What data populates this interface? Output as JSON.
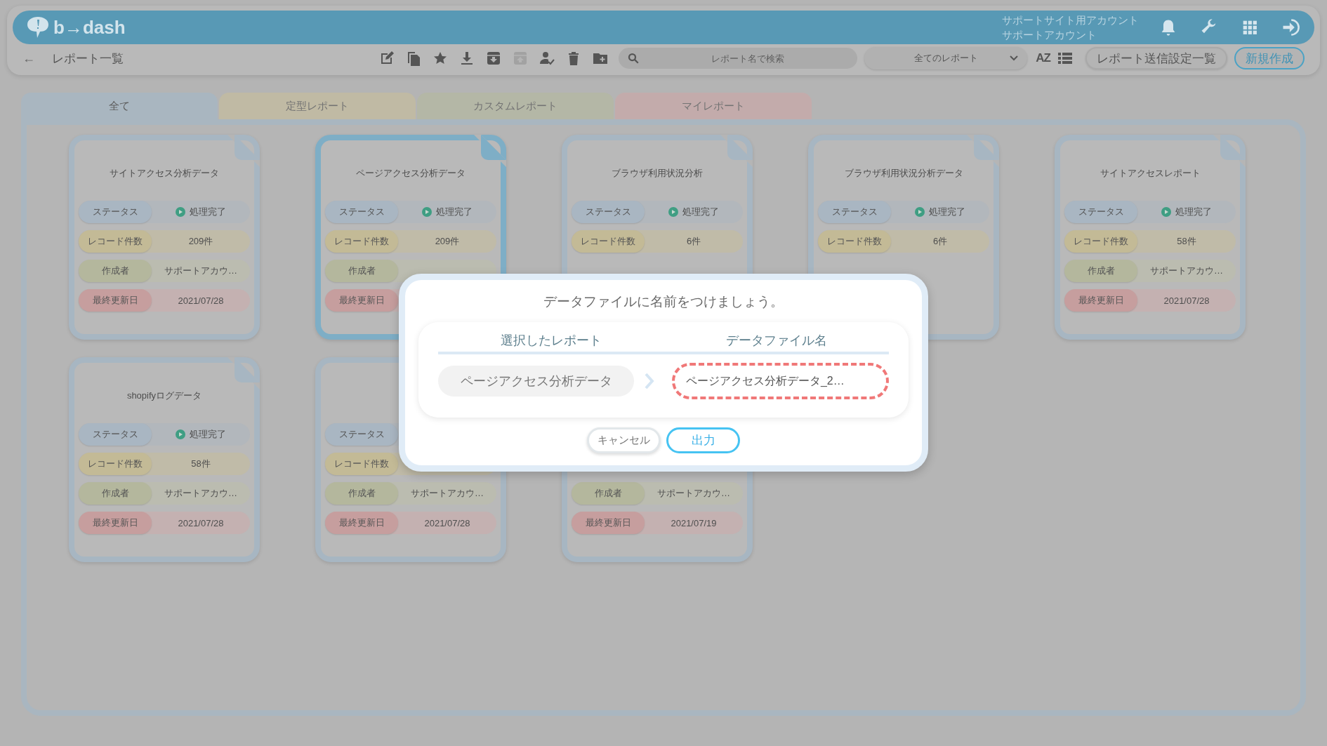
{
  "header": {
    "logo": "b→dash",
    "account": [
      "サポートサイト用アカウント",
      "サポートアカウント"
    ],
    "icons": [
      {
        "kind": "bell"
      },
      {
        "kind": "wrench"
      },
      {
        "kind": "grid"
      },
      {
        "kind": "signin"
      }
    ]
  },
  "toolbar": {
    "back": "←",
    "title": "レポート一覧",
    "tools": [
      {
        "kind": "edit",
        "disabled": false
      },
      {
        "kind": "copy",
        "disabled": false
      },
      {
        "kind": "star",
        "disabled": false
      },
      {
        "kind": "download",
        "disabled": false
      },
      {
        "kind": "archive-down",
        "disabled": false
      },
      {
        "kind": "archive-up",
        "disabled": true
      },
      {
        "kind": "user-check",
        "disabled": false
      },
      {
        "kind": "trash",
        "disabled": false
      },
      {
        "kind": "folder-plus",
        "disabled": false
      }
    ],
    "search": {
      "placeholder": "レポート名で検索"
    },
    "filter": {
      "value": "全てのレポート"
    },
    "sort": "AZ",
    "buttons": [
      {
        "label": "レポート送信設定一覧",
        "kind": "secondary"
      },
      {
        "label": "新規作成",
        "kind": "primary"
      }
    ]
  },
  "tabs": [
    {
      "label": "全て",
      "selected": true,
      "color": "#a9b6c0"
    },
    {
      "label": "定型レポート",
      "selected": false,
      "color": "#c4bc9f"
    },
    {
      "label": "カスタムレポート",
      "selected": false,
      "color": "#b4b8a2"
    },
    {
      "label": "マイレポート",
      "selected": false,
      "color": "#c9a9a9"
    }
  ],
  "cards": [
    {
      "title": "サイトアクセス分析データ",
      "selected": false,
      "fields": [
        {
          "kind": "status",
          "label": "ステータス",
          "value": "処理完了"
        },
        {
          "kind": "records",
          "label": "レコード件数",
          "value": "209件"
        },
        {
          "kind": "author",
          "label": "作成者",
          "value": "サポートアカウ…"
        },
        {
          "kind": "date",
          "label": "最終更新日",
          "value": "2021/07/28"
        }
      ]
    },
    {
      "title": "ページアクセス分析データ",
      "selected": true,
      "fields": [
        {
          "kind": "status",
          "label": "ステータス",
          "value": "処理完了"
        },
        {
          "kind": "records",
          "label": "レコード件数",
          "value": "209件"
        },
        {
          "kind": "author",
          "label": "作成者"
        },
        {
          "kind": "date",
          "label": "最終更新日"
        }
      ]
    },
    {
      "title": "ブラウザ利用状況分析",
      "selected": false,
      "fields": [
        {
          "kind": "status",
          "label": "ステータス",
          "value": "処理完了"
        },
        {
          "kind": "records",
          "label": "レコード件数",
          "value": "6件"
        },
        {
          "kind": "author"
        },
        {
          "kind": "date"
        }
      ]
    },
    {
      "title": "ブラウザ利用状況分析データ",
      "selected": false,
      "fields": [
        {
          "kind": "status",
          "label": "ステータス",
          "value": "処理完了"
        },
        {
          "kind": "records",
          "label": "レコード件数",
          "value": "6件"
        },
        {
          "kind": "author"
        },
        {
          "kind": "date"
        }
      ]
    },
    {
      "title": "サイトアクセスレポート",
      "selected": false,
      "fields": [
        {
          "kind": "status",
          "label": "ステータス",
          "value": "処理完了"
        },
        {
          "kind": "records",
          "label": "レコード件数",
          "value": "58件"
        },
        {
          "kind": "author",
          "label": "作成者",
          "value": "サポートアカウ…"
        },
        {
          "kind": "date",
          "label": "最終更新日",
          "value": "2021/07/28"
        }
      ]
    },
    {
      "title": "shopifyログデータ",
      "selected": false,
      "fields": [
        {
          "kind": "status",
          "label": "ステータス",
          "value": "処理完了"
        },
        {
          "kind": "records",
          "label": "レコード件数",
          "value": "58件"
        },
        {
          "kind": "author",
          "label": "作成者",
          "value": "サポートアカウ…"
        },
        {
          "kind": "date",
          "label": "最終更新日",
          "value": "2021/07/28"
        }
      ]
    },
    {
      "selected": false,
      "fields": [
        {
          "kind": "status",
          "label": "ステータス"
        },
        {
          "kind": "records",
          "label": "レコード件数"
        },
        {
          "kind": "author",
          "label": "作成者",
          "value": "サポートアカウ…"
        },
        {
          "kind": "date",
          "label": "最終更新日",
          "value": "2021/07/28"
        }
      ]
    },
    {
      "selected": false,
      "fields": [
        {
          "kind": "status"
        },
        {
          "kind": "records"
        },
        {
          "kind": "author",
          "label": "作成者",
          "value": "サポートアカウ…"
        },
        {
          "kind": "date",
          "label": "最終更新日",
          "value": "2021/07/19"
        }
      ]
    }
  ],
  "dialog": {
    "title": "データファイルに名前をつけましょう。",
    "columns": [
      "選択したレポート",
      "データファイル名"
    ],
    "selected_report": "ページアクセス分析データ",
    "file_name": {
      "value": "ページアクセス分析データ_2…"
    },
    "buttons": [
      {
        "label": "キャンセル",
        "kind": "cancel"
      },
      {
        "label": "出力",
        "kind": "primary"
      }
    ]
  }
}
